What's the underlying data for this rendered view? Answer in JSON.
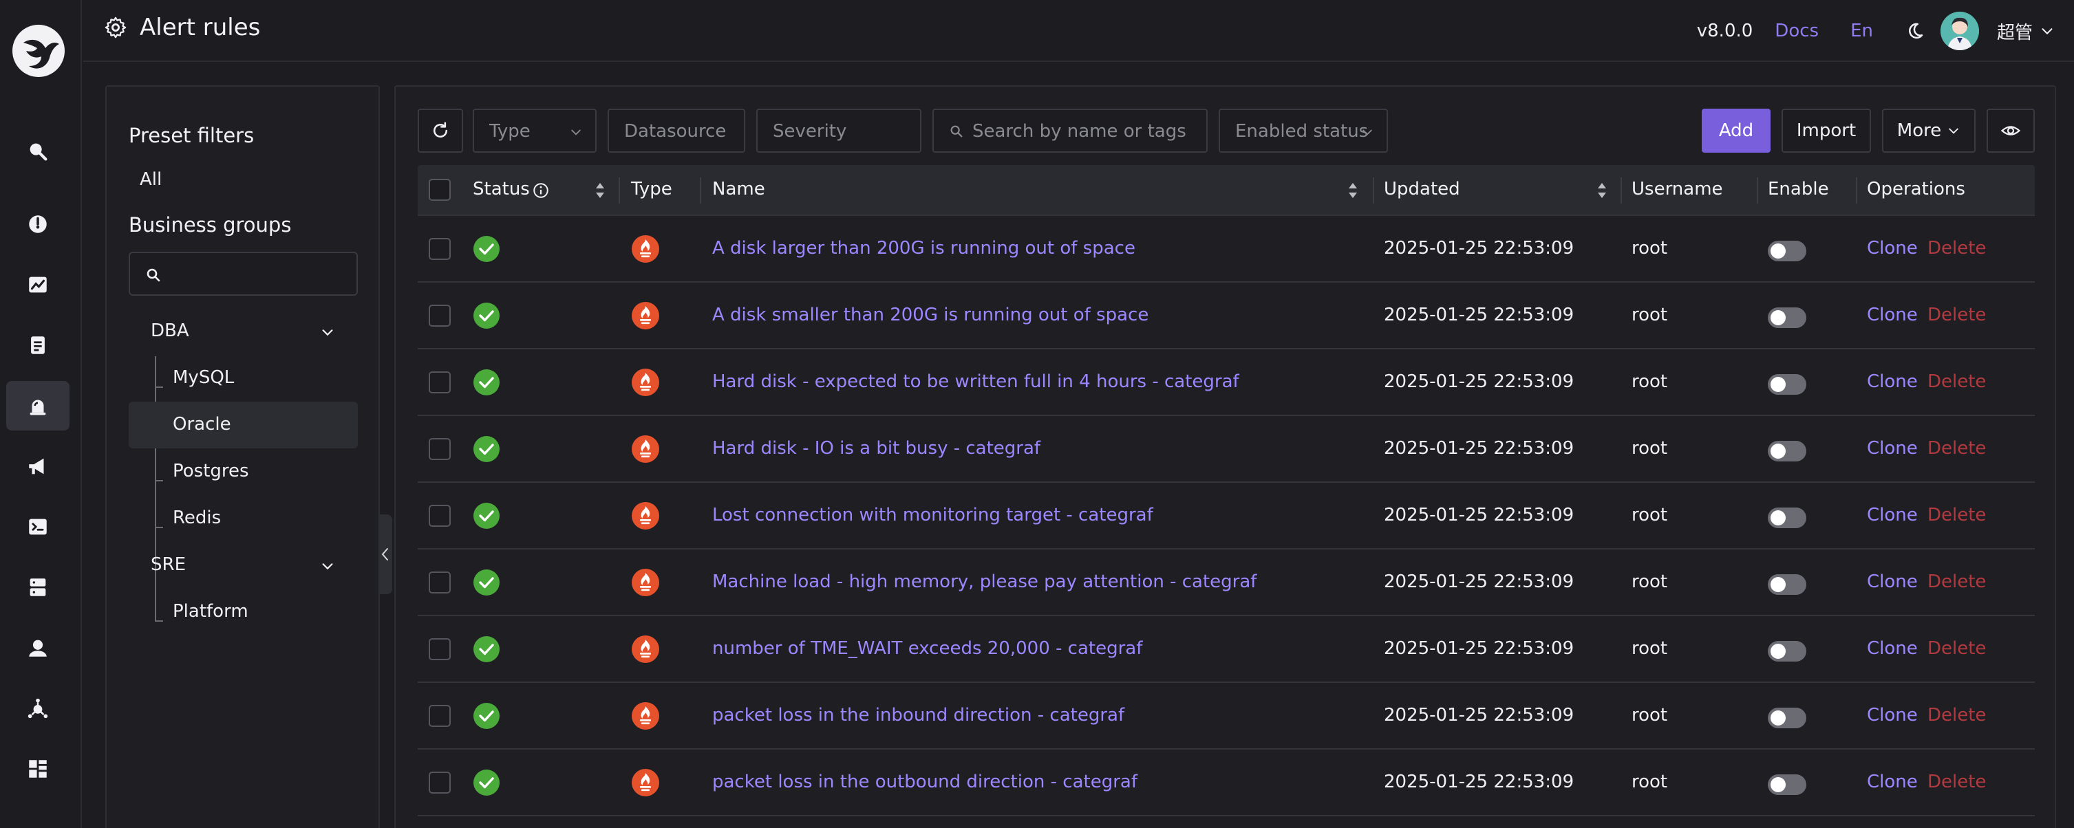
{
  "header": {
    "title": "Alert rules",
    "version": "v8.0.0",
    "docs_label": "Docs",
    "lang_label": "En",
    "username": "超管"
  },
  "sidebar": {
    "preset_heading": "Preset filters",
    "all_label": "All",
    "groups_heading": "Business groups",
    "search_value": "",
    "groups": [
      {
        "label": "DBA",
        "children": [
          "MySQL",
          "Oracle",
          "Postgres",
          "Redis"
        ]
      },
      {
        "label": "SRE",
        "children": [
          "Platform"
        ]
      }
    ],
    "selected": "Oracle"
  },
  "toolbar": {
    "type_placeholder": "Type",
    "datasource_placeholder": "Datasource",
    "severity_placeholder": "Severity",
    "search_placeholder": "Search by name or tags",
    "enabled_placeholder": "Enabled status",
    "add_label": "Add",
    "import_label": "Import",
    "more_label": "More"
  },
  "table": {
    "columns": {
      "status": "Status",
      "type": "Type",
      "name": "Name",
      "updated": "Updated",
      "username": "Username",
      "enable": "Enable",
      "operations": "Operations"
    },
    "clone_label": "Clone",
    "delete_label": "Delete",
    "rows": [
      {
        "name": "A disk larger than 200G is running out of space",
        "updated": "2025-01-25 22:53:09",
        "username": "root",
        "enabled": false
      },
      {
        "name": "A disk smaller than 200G is running out of space",
        "updated": "2025-01-25 22:53:09",
        "username": "root",
        "enabled": false
      },
      {
        "name": "Hard disk - expected to be written full in 4 hours - categraf",
        "updated": "2025-01-25 22:53:09",
        "username": "root",
        "enabled": false
      },
      {
        "name": "Hard disk - IO is a bit busy - categraf",
        "updated": "2025-01-25 22:53:09",
        "username": "root",
        "enabled": false
      },
      {
        "name": "Lost connection with monitoring target - categraf",
        "updated": "2025-01-25 22:53:09",
        "username": "root",
        "enabled": false
      },
      {
        "name": "Machine load - high memory, please pay attention - categraf",
        "updated": "2025-01-25 22:53:09",
        "username": "root",
        "enabled": false
      },
      {
        "name": "number of TME_WAIT exceeds 20,000 - categraf",
        "updated": "2025-01-25 22:53:09",
        "username": "root",
        "enabled": false
      },
      {
        "name": "packet loss in the inbound direction - categraf",
        "updated": "2025-01-25 22:53:09",
        "username": "root",
        "enabled": false
      },
      {
        "name": "packet loss in the outbound direction - categraf",
        "updated": "2025-01-25 22:53:09",
        "username": "root",
        "enabled": false
      }
    ]
  },
  "colors": {
    "accent": "#7a5fdc",
    "link": "#9d87ff",
    "danger": "#b03a3f",
    "status_ok": "#4aaa3a",
    "prometheus": "#e6522c"
  }
}
